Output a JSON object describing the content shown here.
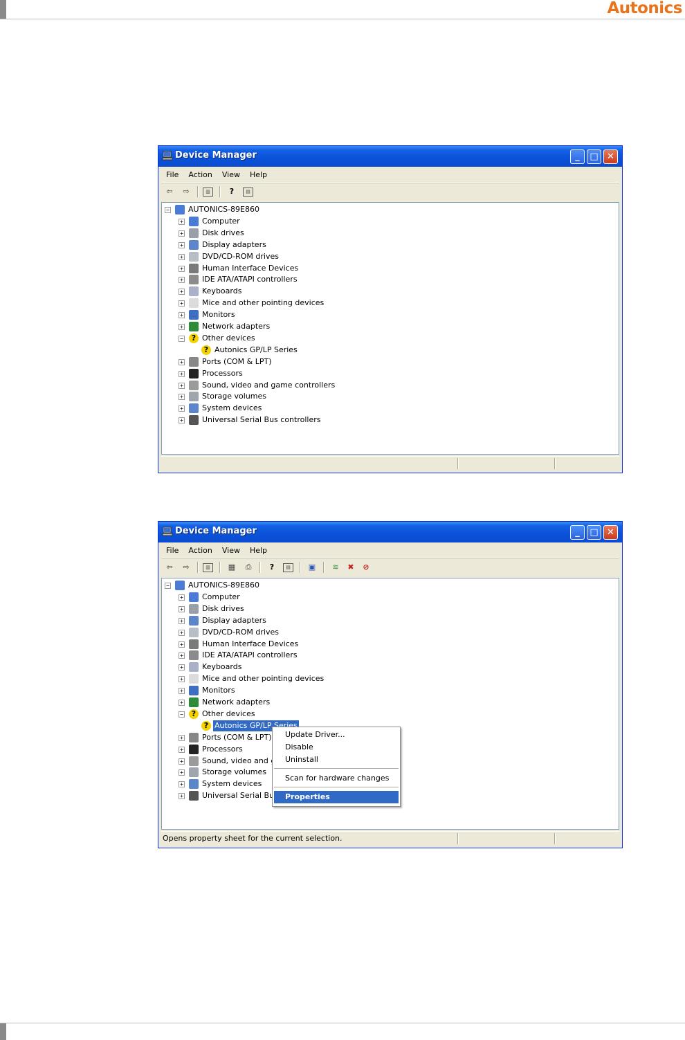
{
  "brand": {
    "logo_text": "Autonics"
  },
  "window1": {
    "title": "Device Manager",
    "menu": [
      "File",
      "Action",
      "View",
      "Help"
    ],
    "root": "AUTONICS-89E860",
    "devices": [
      "Computer",
      "Disk drives",
      "Display adapters",
      "DVD/CD-ROM drives",
      "Human Interface Devices",
      "IDE ATA/ATAPI controllers",
      "Keyboards",
      "Mice and other pointing devices",
      "Monitors",
      "Network adapters",
      "Other devices",
      "Autonics GP/LP Series",
      "Ports (COM & LPT)",
      "Processors",
      "Sound, video and game controllers",
      "Storage volumes",
      "System devices",
      "Universal Serial Bus controllers"
    ],
    "status_text": ""
  },
  "window2": {
    "title": "Device Manager",
    "menu": [
      "File",
      "Action",
      "View",
      "Help"
    ],
    "root": "AUTONICS-89E860",
    "devices": [
      "Computer",
      "Disk drives",
      "Display adapters",
      "DVD/CD-ROM drives",
      "Human Interface Devices",
      "IDE ATA/ATAPI controllers",
      "Keyboards",
      "Mice and other pointing devices",
      "Monitors",
      "Network adapters",
      "Other devices",
      "Autonics GP/LP Series",
      "Ports (COM & LPT)",
      "Processors",
      "Sound, video and g",
      "Storage volumes",
      "System devices",
      "Universal Serial Bus"
    ],
    "selected": "Autonics GP/LP Series",
    "status_text": "Opens property sheet for the current selection.",
    "context_menu": {
      "items": [
        "Update Driver...",
        "Disable",
        "Uninstall",
        "Scan for hardware changes",
        "Properties"
      ],
      "highlighted": "Properties"
    }
  },
  "icons": {
    "Computer": "computer-icon",
    "Disk drives": "disk-drive-icon",
    "Display adapters": "display-adapter-icon",
    "DVD/CD-ROM drives": "dvd-drive-icon",
    "Human Interface Devices": "hid-icon",
    "IDE ATA/ATAPI controllers": "ide-controller-icon",
    "Keyboards": "keyboard-icon",
    "Mice and other pointing devices": "mouse-icon",
    "Monitors": "monitor-icon",
    "Network adapters": "network-adapter-icon",
    "Other devices": "unknown-device-icon",
    "Autonics GP/LP Series": "unknown-device-icon",
    "Ports (COM & LPT)": "port-icon",
    "Processors": "processor-icon",
    "Sound": "sound-icon",
    "Storage volumes": "storage-volume-icon",
    "System devices": "system-device-icon",
    "Universal Serial Bus": "usb-icon"
  },
  "colors": {
    "title_blue": "#0a52d8",
    "selection": "#316ac5",
    "brand_orange": "#e8731c",
    "window_face": "#ece9d8"
  }
}
